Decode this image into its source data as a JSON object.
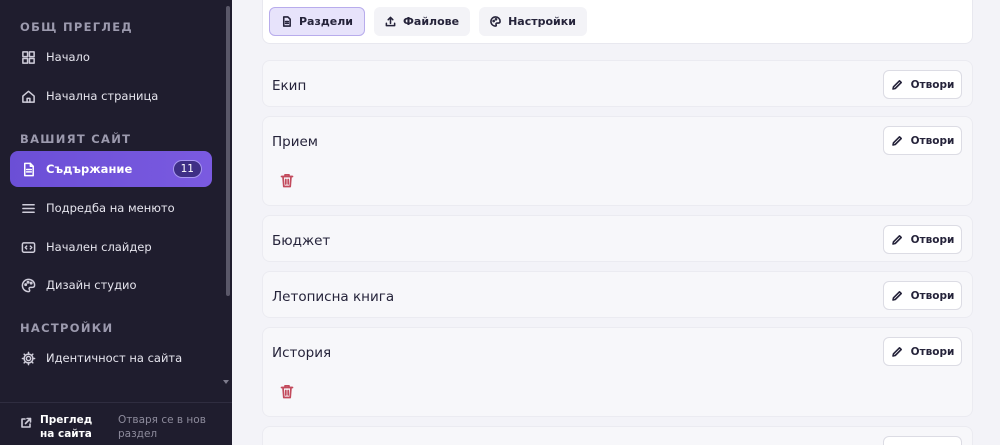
{
  "sidebar": {
    "sections": [
      {
        "label": "ОБЩ ПРЕГЛЕД"
      },
      {
        "label": "ВАШИЯТ САЙТ"
      },
      {
        "label": "НАСТРОЙКИ"
      }
    ],
    "items": [
      {
        "label": "Начало",
        "icon": "grid-icon"
      },
      {
        "label": "Начална страница",
        "icon": "home-icon"
      },
      {
        "label": "Съдържание",
        "icon": "file-text-icon",
        "badge": "11",
        "active": true
      },
      {
        "label": "Подредба на менюто",
        "icon": "menu-lines-icon"
      },
      {
        "label": "Начален слайдер",
        "icon": "slider-icon"
      },
      {
        "label": "Дизайн студио",
        "icon": "palette-icon"
      },
      {
        "label": "Идентичност на сайта",
        "icon": "gear-icon"
      }
    ],
    "footer": {
      "title": "Преглед на сайта",
      "subtitle": "Отваря се в нов раздел",
      "icon": "external-link-icon"
    }
  },
  "toolbar": {
    "tabs": [
      {
        "label": "Раздели",
        "icon": "file-text-icon",
        "active": true
      },
      {
        "label": "Файлове",
        "icon": "upload-icon"
      },
      {
        "label": "Настройки",
        "icon": "palette-icon"
      }
    ]
  },
  "sections": [
    {
      "title": "Екип",
      "open_label": "Отвори"
    },
    {
      "title": "Прием",
      "open_label": "Отвори",
      "deletable": true
    },
    {
      "title": "Бюджет",
      "open_label": "Отвори"
    },
    {
      "title": "Летописна книга",
      "open_label": "Отвори"
    },
    {
      "title": "История",
      "open_label": "Отвори",
      "deletable": true
    },
    {
      "title": "",
      "open_label": ""
    }
  ],
  "colors": {
    "sidebar_bg": "#1f1d2e",
    "accent": "#6b4fd6",
    "danger": "#c24a5c"
  }
}
